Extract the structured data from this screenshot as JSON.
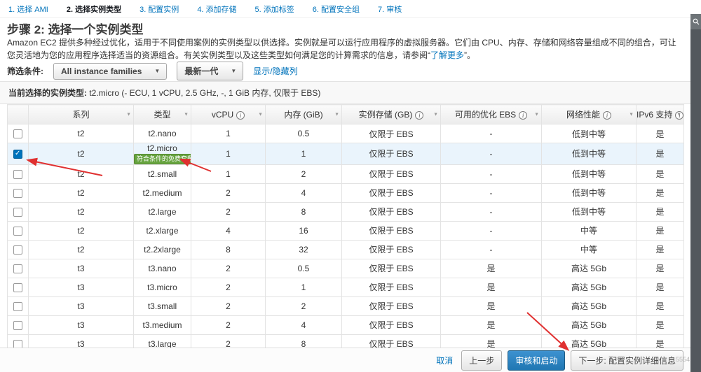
{
  "wizard": {
    "steps": [
      {
        "label": "1. 选择 AMI",
        "active": false
      },
      {
        "label": "2. 选择实例类型",
        "active": true
      },
      {
        "label": "3. 配置实例",
        "active": false
      },
      {
        "label": "4. 添加存储",
        "active": false
      },
      {
        "label": "5. 添加标签",
        "active": false
      },
      {
        "label": "6. 配置安全组",
        "active": false
      },
      {
        "label": "7. 审核",
        "active": false
      }
    ]
  },
  "header": {
    "title": "步骤 2: 选择一个实例类型",
    "description": "Amazon EC2 提供多种经过优化，适用于不同使用案例的实例类型以供选择。实例就是可以运行应用程序的虚拟服务器。它们由 CPU、内存、存储和网络容量组成不同的组合，可让您灵活地为您的应用程序选择适当的资源组合。有关实例类型以及这些类型如何满足您的计算需求的信息，请参阅“",
    "learn_more_link": "了解更多",
    "description_suffix": "”。"
  },
  "filters": {
    "label": "筛选条件:",
    "family_filter": "All instance families",
    "generation_filter": "最新一代",
    "show_hide_columns_link": "显示/隐藏列"
  },
  "selection_bar": {
    "label": "当前选择的实例类型:",
    "value": "t2.micro (- ECU, 1 vCPU, 2.5 GHz, -, 1 GiB 内存, 仅限于 EBS)"
  },
  "table": {
    "columns": [
      {
        "label": "系列",
        "info": false
      },
      {
        "label": "类型",
        "info": false
      },
      {
        "label": "vCPU",
        "info": true
      },
      {
        "label": "内存 (GiB)",
        "info": false
      },
      {
        "label": "实例存储 (GB)",
        "info": true
      },
      {
        "label": "可用的优化 EBS",
        "info": true
      },
      {
        "label": "网络性能",
        "info": true
      },
      {
        "label": "IPv6 支持",
        "info": true
      }
    ],
    "free_tier_badge": "符合条件的免费套餐",
    "rows": [
      {
        "family": "t2",
        "type": "t2.nano",
        "free_tier": false,
        "vcpu": "1",
        "memory": "0.5",
        "storage": "仅限于 EBS",
        "ebs_optimized": "-",
        "network": "低到中等",
        "ipv6": "是",
        "selected": false
      },
      {
        "family": "t2",
        "type": "t2.micro",
        "free_tier": true,
        "vcpu": "1",
        "memory": "1",
        "storage": "仅限于 EBS",
        "ebs_optimized": "-",
        "network": "低到中等",
        "ipv6": "是",
        "selected": true
      },
      {
        "family": "t2",
        "type": "t2.small",
        "free_tier": false,
        "vcpu": "1",
        "memory": "2",
        "storage": "仅限于 EBS",
        "ebs_optimized": "-",
        "network": "低到中等",
        "ipv6": "是",
        "selected": false
      },
      {
        "family": "t2",
        "type": "t2.medium",
        "free_tier": false,
        "vcpu": "2",
        "memory": "4",
        "storage": "仅限于 EBS",
        "ebs_optimized": "-",
        "network": "低到中等",
        "ipv6": "是",
        "selected": false
      },
      {
        "family": "t2",
        "type": "t2.large",
        "free_tier": false,
        "vcpu": "2",
        "memory": "8",
        "storage": "仅限于 EBS",
        "ebs_optimized": "-",
        "network": "低到中等",
        "ipv6": "是",
        "selected": false
      },
      {
        "family": "t2",
        "type": "t2.xlarge",
        "free_tier": false,
        "vcpu": "4",
        "memory": "16",
        "storage": "仅限于 EBS",
        "ebs_optimized": "-",
        "network": "中等",
        "ipv6": "是",
        "selected": false
      },
      {
        "family": "t2",
        "type": "t2.2xlarge",
        "free_tier": false,
        "vcpu": "8",
        "memory": "32",
        "storage": "仅限于 EBS",
        "ebs_optimized": "-",
        "network": "中等",
        "ipv6": "是",
        "selected": false
      },
      {
        "family": "t3",
        "type": "t3.nano",
        "free_tier": false,
        "vcpu": "2",
        "memory": "0.5",
        "storage": "仅限于 EBS",
        "ebs_optimized": "是",
        "network": "高达 5Gb",
        "ipv6": "是",
        "selected": false
      },
      {
        "family": "t3",
        "type": "t3.micro",
        "free_tier": false,
        "vcpu": "2",
        "memory": "1",
        "storage": "仅限于 EBS",
        "ebs_optimized": "是",
        "network": "高达 5Gb",
        "ipv6": "是",
        "selected": false
      },
      {
        "family": "t3",
        "type": "t3.small",
        "free_tier": false,
        "vcpu": "2",
        "memory": "2",
        "storage": "仅限于 EBS",
        "ebs_optimized": "是",
        "network": "高达 5Gb",
        "ipv6": "是",
        "selected": false
      },
      {
        "family": "t3",
        "type": "t3.medium",
        "free_tier": false,
        "vcpu": "2",
        "memory": "4",
        "storage": "仅限于 EBS",
        "ebs_optimized": "是",
        "network": "高达 5Gb",
        "ipv6": "是",
        "selected": false
      },
      {
        "family": "t3",
        "type": "t3.large",
        "free_tier": false,
        "vcpu": "2",
        "memory": "8",
        "storage": "仅限于 EBS",
        "ebs_optimized": "是",
        "network": "高达 5Gb",
        "ipv6": "是",
        "selected": false
      }
    ]
  },
  "footer": {
    "cancel": "取消",
    "previous": "上一步",
    "review_and_launch": "审核和启动",
    "next": "下一步: 配置实例详细信息"
  },
  "watermark": "5554",
  "colors": {
    "link": "#0073bb",
    "primary_button": "#2077b2",
    "free_tier_badge": "#67a440",
    "selected_row": "#eaf4fc",
    "annotation_arrow": "#e03030"
  }
}
